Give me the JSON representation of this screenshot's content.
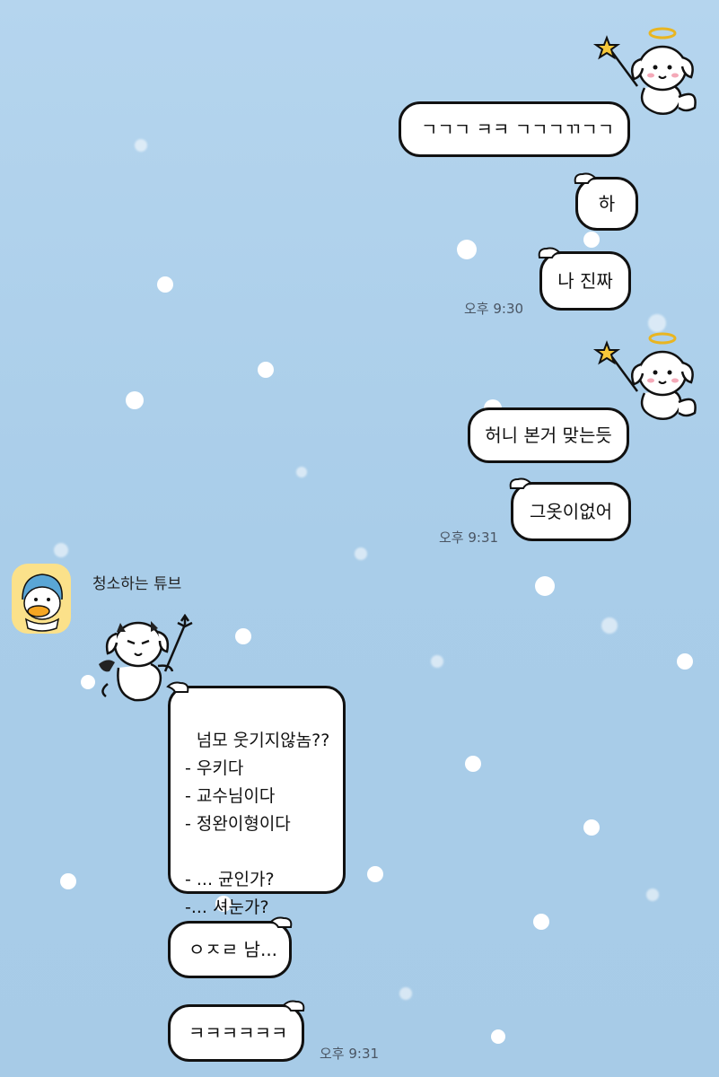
{
  "chat": {
    "sender_name": "청소하는 튜브",
    "messages_sent": [
      {
        "text": "ㄱㄱㄱ ㅋㅋ ㄱㄱㄱㄲㄱㄱ"
      },
      {
        "text": "하"
      },
      {
        "text": "나 진짜"
      },
      {
        "text": "허니 본거 맞는듯"
      },
      {
        "text": "그옷이없어"
      }
    ],
    "messages_received": [
      {
        "text": "넘모 웃기지않놈??\n- 우키다\n- 교수님이다\n- 정완이형이다\n\n- ... 균인가?\n-... 셔눈가?"
      },
      {
        "text": "ㅇㅈㄹ 남..."
      },
      {
        "text": "ㅋㅋㅋㅋㅋㅋ"
      }
    ],
    "timestamps": [
      "오후 9:30",
      "오후 9:31",
      "오후 9:31"
    ]
  },
  "stickers": {
    "sent_1": "angel-puppy-sticker",
    "sent_2": "angel-puppy-sticker",
    "received": "devil-puppy-sticker",
    "avatar": "tube-duck-avatar"
  },
  "colors": {
    "background": "#b5d5ee",
    "bubble": "#ffffff",
    "outline": "#111111",
    "avatar_bg": "#fbe18a"
  }
}
